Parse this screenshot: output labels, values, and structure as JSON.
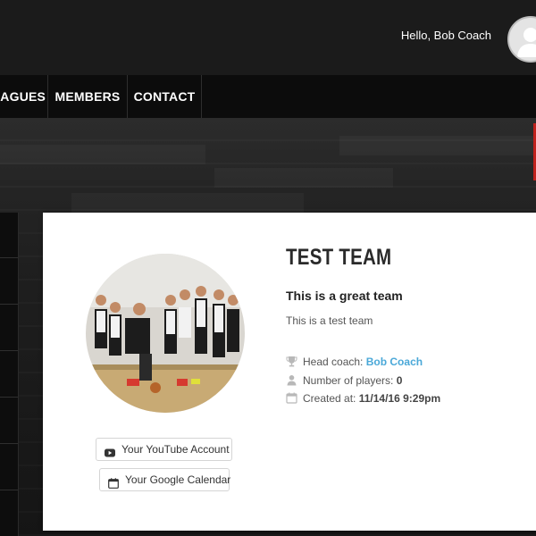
{
  "header": {
    "greeting": "Hello, Bob Coach",
    "avatar_icon": "user-avatar-icon"
  },
  "nav": {
    "items": [
      {
        "label": "LEAGUES"
      },
      {
        "label": "MEMBERS"
      },
      {
        "label": "CONTACT"
      }
    ]
  },
  "team": {
    "name": "TEST TEAM",
    "tagline": "This is a great team",
    "description": "This is a test team",
    "head_coach_label": "Head coach:",
    "head_coach_value": "Bob Coach",
    "players_label": "Number of players:",
    "players_value": "0",
    "created_label": "Created at:",
    "created_value": "11/14/16 9:29pm"
  },
  "buttons": {
    "youtube": "Your YouTube Account",
    "calendar": "Your Google Calendar"
  },
  "colors": {
    "link": "#4aa8d8",
    "accent": "#c0211d"
  }
}
